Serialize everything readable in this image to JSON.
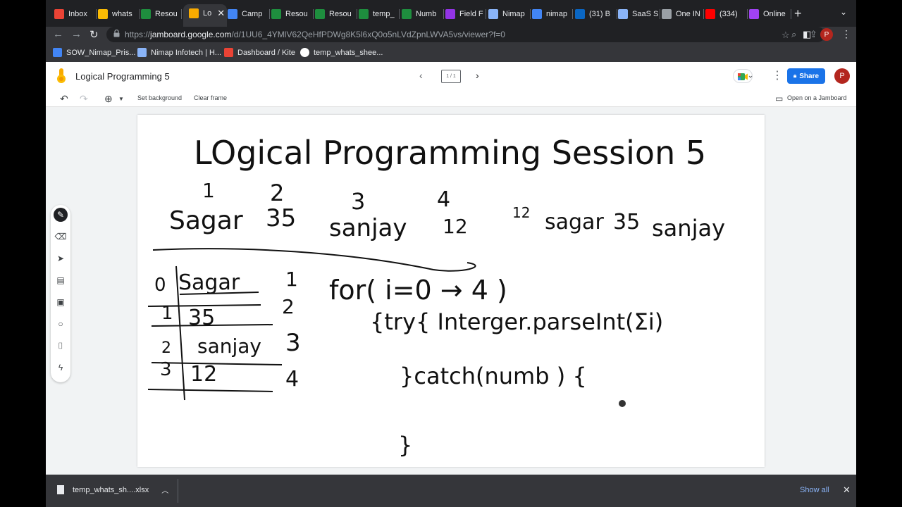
{
  "browser": {
    "tabs": [
      {
        "label": "Inbox",
        "icon": "gmail-icon",
        "color": "#ea4335"
      },
      {
        "label": "whats",
        "icon": "drive-icon",
        "color": "#fbbc04"
      },
      {
        "label": "Resou",
        "icon": "sheets-icon",
        "color": "#1e8e3e"
      },
      {
        "label": "Lo",
        "icon": "jamboard-icon",
        "color": "#f9ab00"
      },
      {
        "label": "Camp",
        "icon": "docs-icon",
        "color": "#4285f4"
      },
      {
        "label": "Resou",
        "icon": "sheets-icon",
        "color": "#1e8e3e"
      },
      {
        "label": "Resou",
        "icon": "sheets-icon",
        "color": "#1e8e3e"
      },
      {
        "label": "temp_",
        "icon": "sheets-icon",
        "color": "#1e8e3e"
      },
      {
        "label": "Numb",
        "icon": "sheets-icon",
        "color": "#1e8e3e"
      },
      {
        "label": "Field F",
        "icon": "salesforce-icon",
        "color": "#9334e6"
      },
      {
        "label": "Nimap",
        "icon": "nimap-icon",
        "color": "#8ab4f8"
      },
      {
        "label": "nimap",
        "icon": "calendar-icon",
        "color": "#4285f4"
      },
      {
        "label": "(31) B",
        "icon": "linkedin-icon",
        "color": "#0a66c2"
      },
      {
        "label": "SaaS S",
        "icon": "nimap-icon",
        "color": "#8ab4f8"
      },
      {
        "label": "One IN",
        "icon": "one-icon",
        "color": "#9aa0a6"
      },
      {
        "label": "(334)",
        "icon": "youtube-icon",
        "color": "#ff0000"
      },
      {
        "label": "Online",
        "icon": "online-icon",
        "color": "#a142f4"
      }
    ],
    "url": {
      "prefix": "https://",
      "host": "jamboard.google.com",
      "path": "/d/1UU6_4YMlV62QeHfPDWg8K5l6xQ0o5nLVdZpnLWVA5vs/viewer?f=0"
    },
    "profile_initial": "P",
    "bookmarks": [
      {
        "label": "SOW_Nimap_Pris...",
        "icon": "docs-icon",
        "color": "#4285f4"
      },
      {
        "label": "Nimap Infotech | H...",
        "icon": "nimap-icon",
        "color": "#8ab4f8"
      },
      {
        "label": "Dashboard / Kite",
        "icon": "kite-icon",
        "color": "#ea4335"
      },
      {
        "label": "temp_whats_shee...",
        "icon": "google-icon",
        "color": "#ffffff"
      }
    ]
  },
  "jamboard": {
    "title": "Logical Programming 5",
    "frame_indicator": "1 / 1",
    "share_label": "Share",
    "profile_initial": "P",
    "toolbar": {
      "set_background": "Set background",
      "clear_frame": "Clear frame",
      "open_on_jamboard": "Open on a Jamboard"
    },
    "tools": [
      "pen",
      "eraser",
      "select",
      "sticky-note",
      "image",
      "circle",
      "text-box",
      "laser"
    ]
  },
  "board_ink": {
    "heading": "LOgical Programming Session 5",
    "col_numbers": [
      "1",
      "2",
      "3",
      "4"
    ],
    "row_items": [
      "Sagar",
      "35",
      "sanjay",
      "12"
    ],
    "reversed_line": [
      "12",
      "sagar",
      "35",
      "sanjay"
    ],
    "table": {
      "indices": [
        "0",
        "1",
        "2",
        "3"
      ],
      "values": [
        "Sagar",
        "35",
        "sanjay",
        "12"
      ],
      "positions": [
        "1",
        "2",
        "3",
        "4"
      ]
    },
    "code": {
      "for_line": "for( i=0 → 4 )",
      "try_line": "{try{ Interger.parseInt(Σi)",
      "catch_line": "}catch(numb ) {",
      "close_brace": "}"
    }
  },
  "downloads": {
    "file_name": "temp_whats_sh....xlsx",
    "show_all": "Show all"
  }
}
